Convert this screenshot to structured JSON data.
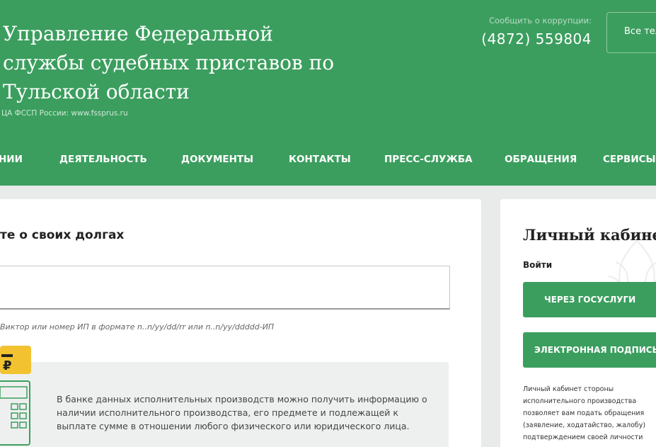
{
  "header": {
    "title": "Управление Федеральной службы судебных приставов по Тульской области",
    "subline": "ЦА ФССП России:  www.fssprus.ru",
    "report_label": "Сообщить о коррупции:",
    "phone": "(4872) 559804",
    "all_button": "Все телефоны"
  },
  "nav": {
    "items": [
      "НИИ",
      "ДЕЯТЕЛЬНОСТЬ",
      "ДОКУМЕНТЫ",
      "КОНТАКТЫ",
      "ПРЕСС-СЛУЖБА",
      "ОБРАЩЕНИЯ",
      "СЕРВИСЫ"
    ]
  },
  "debt": {
    "title": "те о своих долгах",
    "search_value": "",
    "hint": "Виктор или номер ИП в формате n..n/yy/dd/rr или n..n/yy/ddddd-ИП",
    "info": "В банке данных исполнительных производств можно получить информацию о наличии исполнительного производства, его предмете и подлежащей к выплате сумме в отношении любого физического или юридического лица."
  },
  "cabinet": {
    "title": "Личный кабинет",
    "login_label": "Войти",
    "gosuslugi_button": "ЧЕРЕЗ ГОСУСЛУГИ",
    "signature_button": "ЭЛЕКТРОННАЯ ПОДПИСЬ",
    "desc_lines": [
      "Личный кабинет стороны",
      "исполнительного производства",
      "позволяет вам подать обращения",
      "(заявление, ходатайство, жалобу)",
      "подтверждением своей личности"
    ]
  },
  "colors": {
    "brand_green": "#3b9e5e",
    "page_bg": "#e9ebea",
    "info_bg": "#eef0f0",
    "icon_yellow": "#f2c230"
  },
  "icons": {
    "calculator": "calculator-ruble-icon",
    "emblem": "fssp-emblem-watermark"
  }
}
